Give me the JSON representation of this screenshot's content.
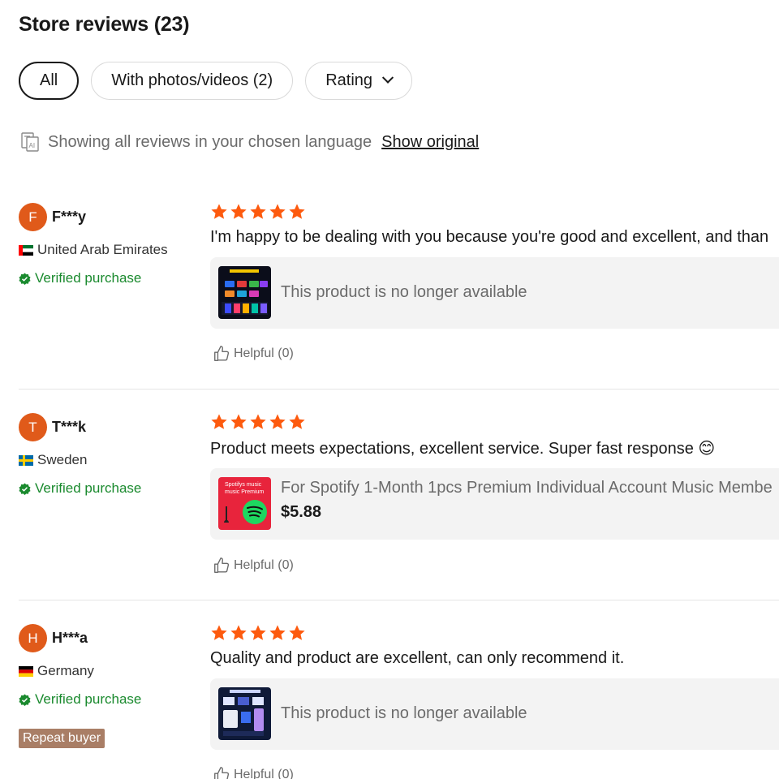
{
  "page": {
    "title": "Store reviews (23)"
  },
  "filters": {
    "all_label": "All",
    "photos_label": "With photos/videos (2)",
    "rating_label": "Rating"
  },
  "language": {
    "notice": "Showing all reviews in your chosen language",
    "show_original": "Show original"
  },
  "colors": {
    "star": "#fd5a0e",
    "verified": "#1a8a2e",
    "avatar": "#e05a1a",
    "repeat_badge": "#a97e66"
  },
  "reviews": [
    {
      "initial": "F",
      "name": "F***y",
      "country": "United Arab Emirates",
      "flag": "uae-flag",
      "verified": "Verified purchase",
      "rating": 5,
      "text": "I'm happy to be dealing with you because you're good and excellent, and than",
      "product_status": "This product is no longer available",
      "helpful": "Helpful (0)"
    },
    {
      "initial": "T",
      "name": "T***k",
      "country": "Sweden",
      "flag": "sweden-flag",
      "verified": "Verified purchase",
      "rating": 5,
      "text": "Product meets expectations, excellent service. Super fast response 😊",
      "product_title": "For Spotify 1-Month 1pcs Premium Individual Account Music Membe",
      "product_price": "$5.88",
      "thumb_text_1": "Spotifys music",
      "thumb_text_2": "music Premium",
      "helpful": "Helpful (0)"
    },
    {
      "initial": "H",
      "name": "H***a",
      "country": "Germany",
      "flag": "germany-flag",
      "verified": "Verified purchase",
      "badge": "Repeat buyer",
      "rating": 5,
      "text": "Quality and product are excellent, can only recommend it.",
      "product_status": "This product is no longer available",
      "helpful": "Helpful (0)"
    }
  ]
}
